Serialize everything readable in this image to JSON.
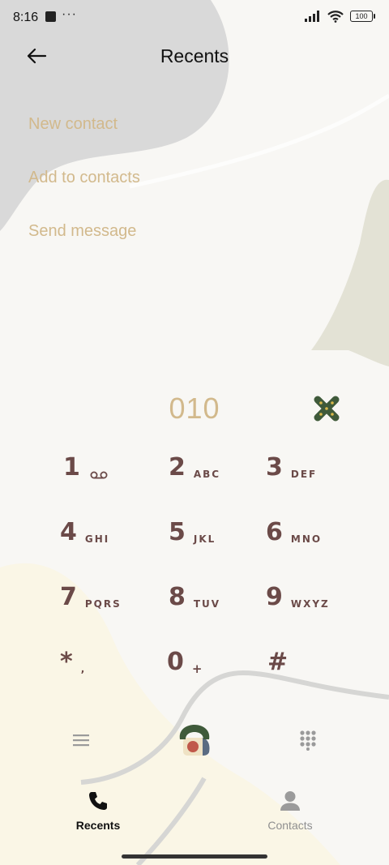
{
  "status_bar": {
    "time": "8:16",
    "dots": "···",
    "battery": "100"
  },
  "header": {
    "title": "Recents"
  },
  "actions": [
    "New contact",
    "Add to contacts",
    "Send message"
  ],
  "dialer": {
    "number": "010"
  },
  "keys": [
    {
      "digit": "1",
      "letters": ""
    },
    {
      "digit": "2",
      "letters": "ABC"
    },
    {
      "digit": "3",
      "letters": "DEF"
    },
    {
      "digit": "4",
      "letters": "GHI"
    },
    {
      "digit": "5",
      "letters": "JKL"
    },
    {
      "digit": "6",
      "letters": "MNO"
    },
    {
      "digit": "7",
      "letters": "PQRS"
    },
    {
      "digit": "8",
      "letters": "TUV"
    },
    {
      "digit": "9",
      "letters": "WXYZ"
    },
    {
      "digit": "*",
      "letters": ","
    },
    {
      "digit": "0",
      "letters": "+"
    },
    {
      "digit": "#",
      "letters": ""
    }
  ],
  "bottom_nav": {
    "recents": "Recents",
    "contacts": "Contacts"
  },
  "colors": {
    "accent_text": "#d2b98c",
    "key_text": "#6b4a48",
    "delete_green": "#3f5a3a"
  },
  "icons": {
    "back": "arrow-left-icon",
    "delete": "delete-x-icon",
    "voicemail": "voicemail-icon",
    "menu": "menu-icon",
    "call": "phone-call-icon",
    "dialpad": "dialpad-icon",
    "recents": "phone-icon",
    "contacts": "person-icon"
  }
}
